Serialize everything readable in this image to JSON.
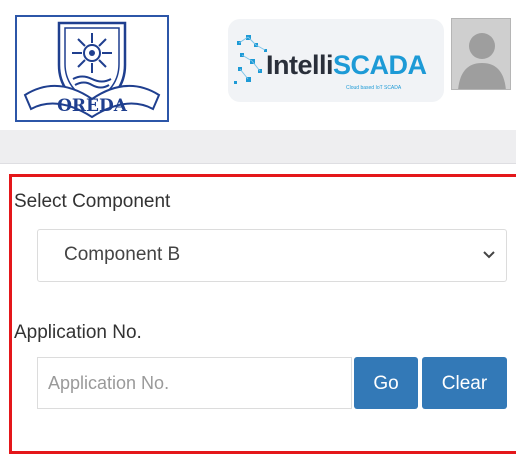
{
  "header": {
    "org_logo": {
      "icon": "oreda-emblem-icon",
      "text": "OREDA"
    },
    "brand_logo": {
      "icon": "intelliscada-logo-icon",
      "name_part1": "Intelli",
      "name_part2": "SCADA",
      "tagline": "Cloud based IoT SCADA"
    },
    "avatar_icon": "user-avatar-icon"
  },
  "form": {
    "component_label": "Select Component",
    "component_selected": "Component B",
    "application_label": "Application No.",
    "application_placeholder": "Application No.",
    "application_value": "",
    "go_label": "Go",
    "clear_label": "Clear"
  },
  "colors": {
    "highlight_border": "#e4171a",
    "button_primary": "#3379b7",
    "brand_blue": "#1d9ad6",
    "logo_blue": "#2c56a8"
  }
}
